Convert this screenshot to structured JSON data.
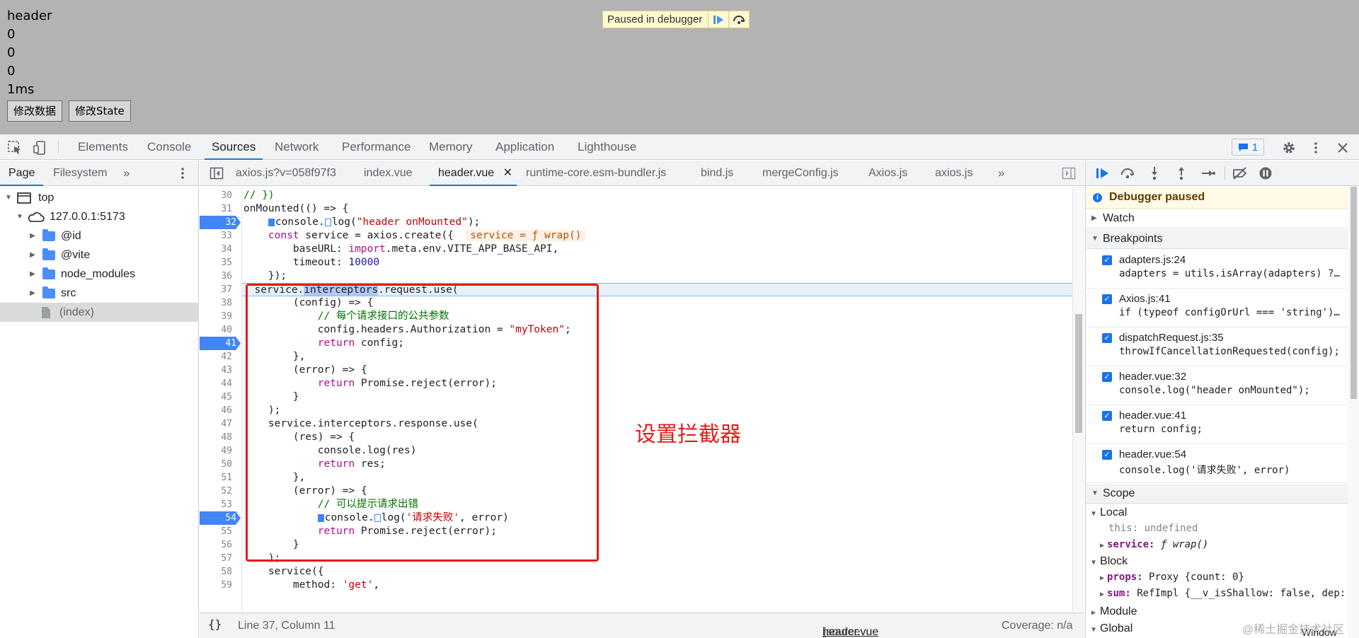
{
  "viewport": {
    "lines": [
      "header",
      "0",
      "0",
      "0",
      "1ms"
    ],
    "buttons": [
      "修改数据",
      "修改State"
    ],
    "paused_banner": "Paused in debugger"
  },
  "devtools_tabs": [
    "Elements",
    "Console",
    "Sources",
    "Network",
    "Performance",
    "Memory",
    "Application",
    "Lighthouse"
  ],
  "active_devtools_tab": "Sources",
  "issues_count": "1",
  "navigator": {
    "tabs": [
      "Page",
      "Filesystem"
    ],
    "tree": [
      {
        "label": "top",
        "level": 0
      },
      {
        "label": "127.0.0.1:5173",
        "level": 1
      },
      {
        "label": "@id",
        "level": 2
      },
      {
        "label": "@vite",
        "level": 2
      },
      {
        "label": "node_modules",
        "level": 2
      },
      {
        "label": "src",
        "level": 2
      },
      {
        "label": "(index)",
        "level": 2
      }
    ]
  },
  "editor_tabs": [
    "axios.js?v=058f97f3",
    "index.vue",
    "header.vue",
    "runtime-core.esm-bundler.js",
    "bind.js",
    "mergeConfig.js",
    "Axios.js",
    "axios.js"
  ],
  "active_editor_tab": "header.vue",
  "line_numbers": [
    "30",
    "31",
    "32",
    "33",
    "34",
    "35",
    "36",
    "37",
    "38",
    "39",
    "40",
    "41",
    "42",
    "43",
    "44",
    "45",
    "46",
    "47",
    "48",
    "49",
    "50",
    "51",
    "52",
    "53",
    "54",
    "55",
    "56",
    "57",
    "58",
    "59"
  ],
  "breakpoint_lines": [
    "32",
    "41",
    "54"
  ],
  "code": {
    "l30": "// })",
    "l31": "onMounted(() => {",
    "l32a": "console.",
    "l32b": "log(",
    "l32c": "\"header onMounted\"",
    "l32d": ");",
    "l33a": "const",
    "l33b": " service = axios.create({  ",
    "l33c": "service = ƒ wrap()",
    "l34a": "baseURL: ",
    "l34b": "import",
    "l34c": ".meta.env.VITE_APP_BASE_API,",
    "l35a": "timeout: ",
    "l35b": "10000",
    "l36": "});",
    "l37a": "service.",
    "l37b": "interceptors",
    "l37c": ".request.use(",
    "l38": "(config) => {",
    "l39": "// 每个请求接口的公共参数",
    "l40a": "config.headers.Authorization = ",
    "l40b": "\"myToken\"",
    "l40c": ";",
    "l41a": "return",
    "l41b": " config;",
    "l42": "},",
    "l43": "(error) => {",
    "l44a": "return",
    "l44b": " Promise.reject(error);",
    "l45": "}",
    "l46": ");",
    "l47": "service.interceptors.response.use(",
    "l48": "(res) => {",
    "l49": "console.log(res)",
    "l50a": "return",
    "l50b": " res;",
    "l51": "},",
    "l52": "(error) => {",
    "l53": "// 可以提示请求出错",
    "l54a": "console.",
    "l54b": "log(",
    "l54c": "'请求失败'",
    "l54d": ", error)",
    "l55a": "return",
    "l55b": " Promise.reject(error);",
    "l56": "}",
    "l57": ");",
    "l58": "service({",
    "l59a": "method: ",
    "l59b": "'get'",
    "l59c": ","
  },
  "annotation": "设置拦截器",
  "status_bar": {
    "position": "Line 37, Column 11",
    "source_mapped_prefix": "(source mapped from ",
    "source_mapped_file": "header.vue",
    "source_mapped_suffix": ")",
    "coverage": "Coverage: n/a"
  },
  "debugger": {
    "paused_message": "Debugger paused",
    "sections": {
      "watch": "Watch",
      "breakpoints": "Breakpoints",
      "scope": "Scope"
    },
    "breakpoints": [
      {
        "location": "adapters.js:24",
        "code": "adapters = utils.isArray(adapters) ? adapters : [adapters];"
      },
      {
        "location": "Axios.js:41",
        "code": "if (typeof configOrUrl === 'string') {"
      },
      {
        "location": "dispatchRequest.js:35",
        "code": "throwIfCancellationRequested(config);"
      },
      {
        "location": "header.vue:32",
        "code": "console.log(\"header onMounted\");"
      },
      {
        "location": "header.vue:41",
        "code": "return config;"
      },
      {
        "location": "header.vue:54",
        "code": "console.log('请求失败', error)"
      }
    ],
    "scope": {
      "local_label": "Local",
      "this_key": "this: ",
      "this_val": "undefined",
      "service_key": "service: ",
      "service_val": "ƒ wrap()",
      "block_label": "Block",
      "props_key": "props: ",
      "props_val": "Proxy {count: 0}",
      "sum_key": "sum: ",
      "sum_val": "RefImpl {__v_isShallow: false, dep: undefined",
      "module_label": "Module",
      "global_label": "Global",
      "window_label": "Window"
    }
  },
  "watermark": "@稀土掘金技术社区",
  "colors": {
    "accent": "#1a73e8",
    "breakpoint": "#4285f4",
    "annotation": "#e41b1b"
  }
}
